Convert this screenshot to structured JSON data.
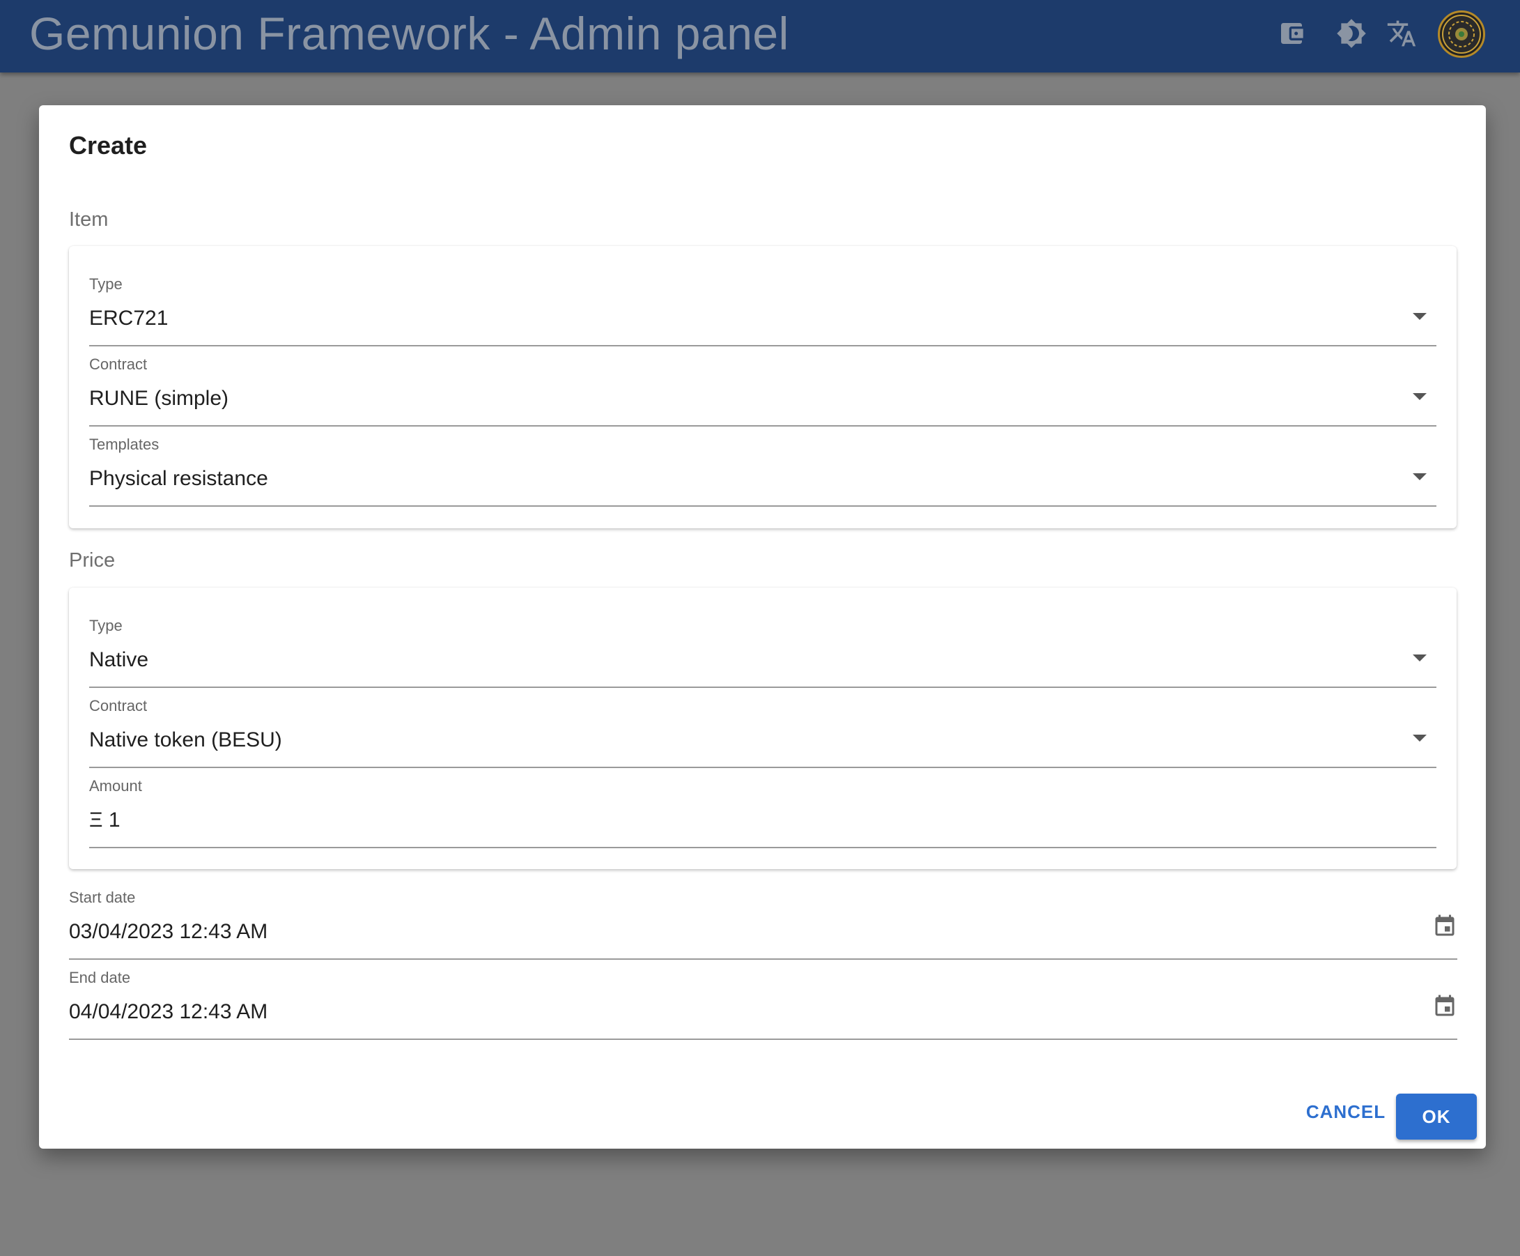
{
  "app": {
    "title": "Gemunion Framework - Admin panel",
    "icons": [
      "wallet-icon",
      "brightness-icon",
      "translate-icon"
    ],
    "avatar": "avatar"
  },
  "dialog": {
    "title": "Create",
    "item_section": {
      "label": "Item",
      "type": {
        "label": "Type",
        "value": "ERC721"
      },
      "contract": {
        "label": "Contract",
        "value": "RUNE (simple)"
      },
      "templates": {
        "label": "Templates",
        "value": "Physical resistance"
      }
    },
    "price_section": {
      "label": "Price",
      "type": {
        "label": "Type",
        "value": "Native"
      },
      "contract": {
        "label": "Contract",
        "value": "Native token (BESU)"
      },
      "amount": {
        "label": "Amount",
        "value": "Ξ 1"
      }
    },
    "start_date": {
      "label": "Start date",
      "value": "03/04/2023 12:43 AM"
    },
    "end_date": {
      "label": "End date",
      "value": "04/04/2023 12:43 AM"
    },
    "cancel_label": "CANCEL",
    "ok_label": "OK"
  },
  "colors": {
    "appbar": "#1d3b6b",
    "primary": "#2d6fcf",
    "backdrop": "#7f7f7f"
  }
}
